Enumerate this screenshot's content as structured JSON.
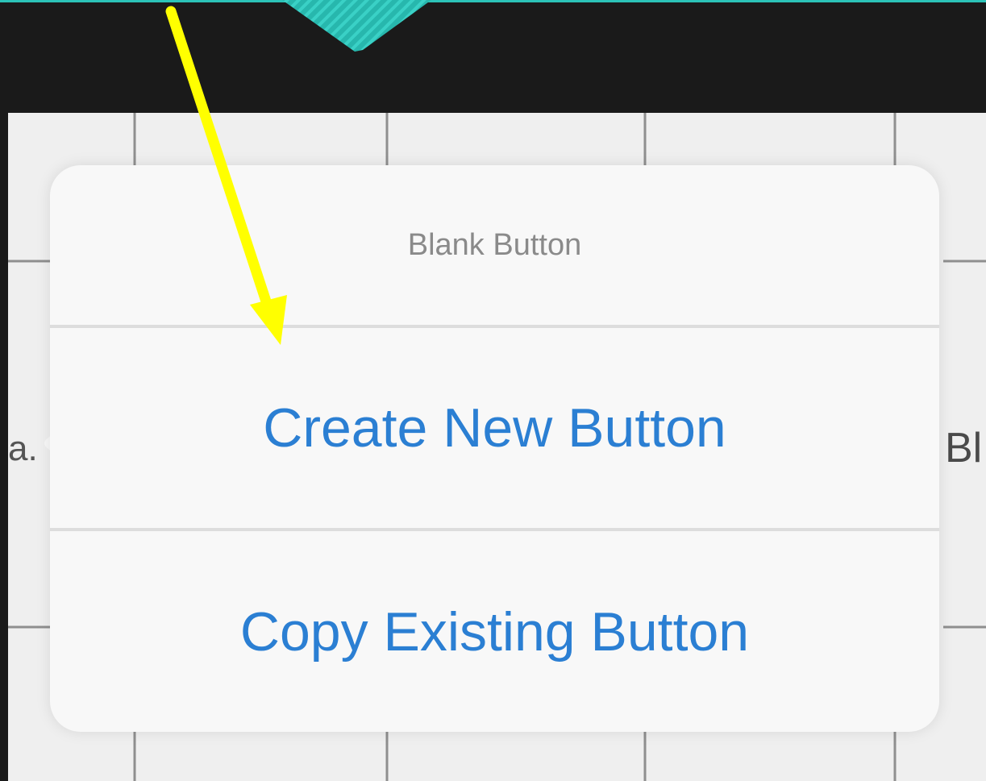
{
  "popover": {
    "title": "Blank Button",
    "actions": [
      {
        "label": "Create New Button"
      },
      {
        "label": "Copy Existing Button"
      }
    ]
  },
  "background": {
    "left_peek_text": "a.",
    "right_peek_text": "Bl"
  },
  "annotation": {
    "arrow_color": "#ffff00",
    "arrow_icon": "pointer-arrow"
  },
  "colors": {
    "accent": "#2b7fd3",
    "teal": "#2cc3b8",
    "frame": "#1a1a1a"
  }
}
